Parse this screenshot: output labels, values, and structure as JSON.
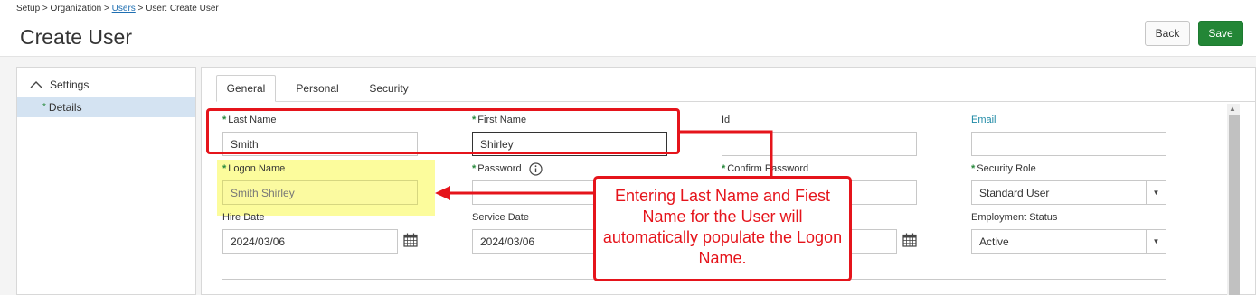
{
  "breadcrumb": {
    "setup": "Setup",
    "sep1": " > ",
    "organization": "Organization",
    "sep2": " > ",
    "users": "Users",
    "sep3": " > ",
    "current": "User: Create User"
  },
  "page": {
    "title": "Create User"
  },
  "toolbar": {
    "back_label": "Back",
    "save_label": "Save"
  },
  "sidebar": {
    "section_label": "Settings",
    "items": [
      {
        "label": "Details",
        "marker": "*"
      }
    ]
  },
  "tabs": [
    {
      "label": "General",
      "active": true
    },
    {
      "label": "Personal",
      "active": false
    },
    {
      "label": "Security",
      "active": false
    }
  ],
  "form": {
    "last_name": {
      "label": "Last Name",
      "required": "*",
      "value": "Smith"
    },
    "first_name": {
      "label": "First Name",
      "required": "*",
      "value": "Shirley"
    },
    "id": {
      "label": "Id",
      "value": ""
    },
    "email": {
      "label": "Email",
      "value": ""
    },
    "logon_name": {
      "label": "Logon Name",
      "required": "*",
      "value": "Smith Shirley"
    },
    "password": {
      "label": "Password",
      "required": "*",
      "value": ""
    },
    "confirm_password": {
      "label": "Confirm Password",
      "required": "*",
      "value": ""
    },
    "security_role": {
      "label": "Security Role",
      "required": "*",
      "value": "Standard User"
    },
    "hire_date": {
      "label": "Hire Date",
      "value": "2024/03/06"
    },
    "service_date": {
      "label": "Service Date",
      "value": "2024/03/06"
    },
    "third_date": {
      "value": ""
    },
    "employment_status": {
      "label": "Employment Status",
      "value": "Active"
    }
  },
  "annotation": {
    "callout_text": "Entering Last Name and Fiest Name for the User will automatically populate the Logon Name.",
    "color": "#e5141b",
    "highlight_color": "#fcfc9c"
  },
  "icons": [
    "chevron-up-icon",
    "info-icon",
    "calendar-icon",
    "chevron-down-icon"
  ],
  "colors": {
    "save": "#238636",
    "selected_sidebar": "#d4e3f2",
    "required_star": "#2a8a3e",
    "link": "#1f6fb2"
  }
}
